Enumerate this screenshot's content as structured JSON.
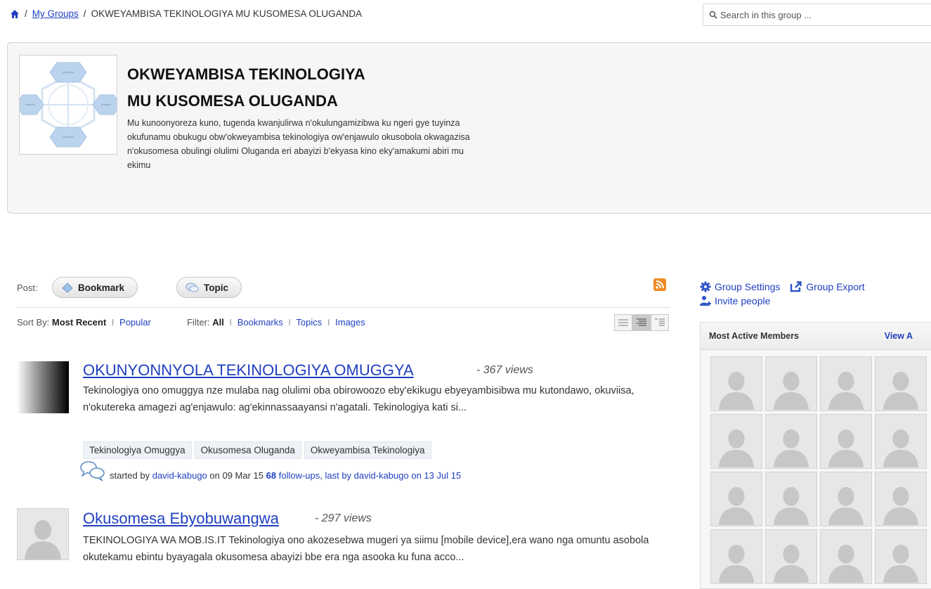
{
  "breadcrumb": {
    "separator": "/",
    "my_groups": "My Groups",
    "current": "OKWEYAMBISA TEKINOLOGIYA MU KUSOMESA OLUGANDA"
  },
  "search": {
    "placeholder": "Search in this group ..."
  },
  "group": {
    "title_line1": "OKWEYAMBISA TEKINOLOGIYA",
    "title_line2": "MU KUSOMESA OLUGANDA",
    "description": "Mu kunoonyoreza kuno, tugenda kwanjulirwa n'okulungamizibwa ku ngeri gye tuyinza okufunamu obukugu obw'okweyambisa tekinologiya ow'enjawulo okusobola okwagazisa n'okusomesa obulingi olulimi Oluganda eri abayizi b'ekyasa kino eky'amakumi abiri mu ekimu"
  },
  "post_bar": {
    "label": "Post:",
    "bookmark": "Bookmark",
    "topic": "Topic"
  },
  "sort": {
    "label": "Sort By:",
    "most_recent": "Most Recent",
    "popular": "Popular",
    "filter_label": "Filter:",
    "all": "All",
    "bookmarks": "Bookmarks",
    "topics": "Topics",
    "images": "Images",
    "sep": "I"
  },
  "posts": [
    {
      "title": "OKUNYONNYOLA TEKINOLOGIYA OMUGGYA",
      "views": "- 367 views",
      "excerpt": "Tekinologiya ono omuggya nze mulaba nag olulimi oba obirowoozo eby'ekikugu ebyeyambisibwa mu kutondawo, okuviisa, n'okutereka amagezi ag'enjawulo: ag'ekinnassaayansi n'agatali. Tekinologiya kati si...",
      "tags": [
        "Tekinologiya Omuggya",
        "Okusomesa Oluganda",
        "Okweyambisa Tekinologiya"
      ],
      "started_by": "started by",
      "author": "david-kabugo",
      "date": "on 09 Mar 15",
      "followups_count": "68",
      "followups_text": "follow-ups, last by david-kabugo on 13 Jul 15"
    },
    {
      "title": "Okusomesa Ebyobuwangwa",
      "views": "- 297 views",
      "excerpt": "TEKINOLOGIYA WA MOB.IS.IT Tekinologiya ono akozesebwa mugeri ya siimu [mobile device],era wano nga omuntu asobola okutekamu ebintu byayagala okusomesa abayizi bbe era nga asooka ku funa acco..."
    }
  ],
  "sidebar": {
    "group_settings": "Group Settings",
    "group_export": "Group Export",
    "invite_people": "Invite people",
    "most_active_title": "Most Active Members",
    "view_all": "View A"
  },
  "colors": {
    "link": "#1f3fc1",
    "rss": "#f08a24",
    "panel_bg": "#f6f6f6"
  }
}
